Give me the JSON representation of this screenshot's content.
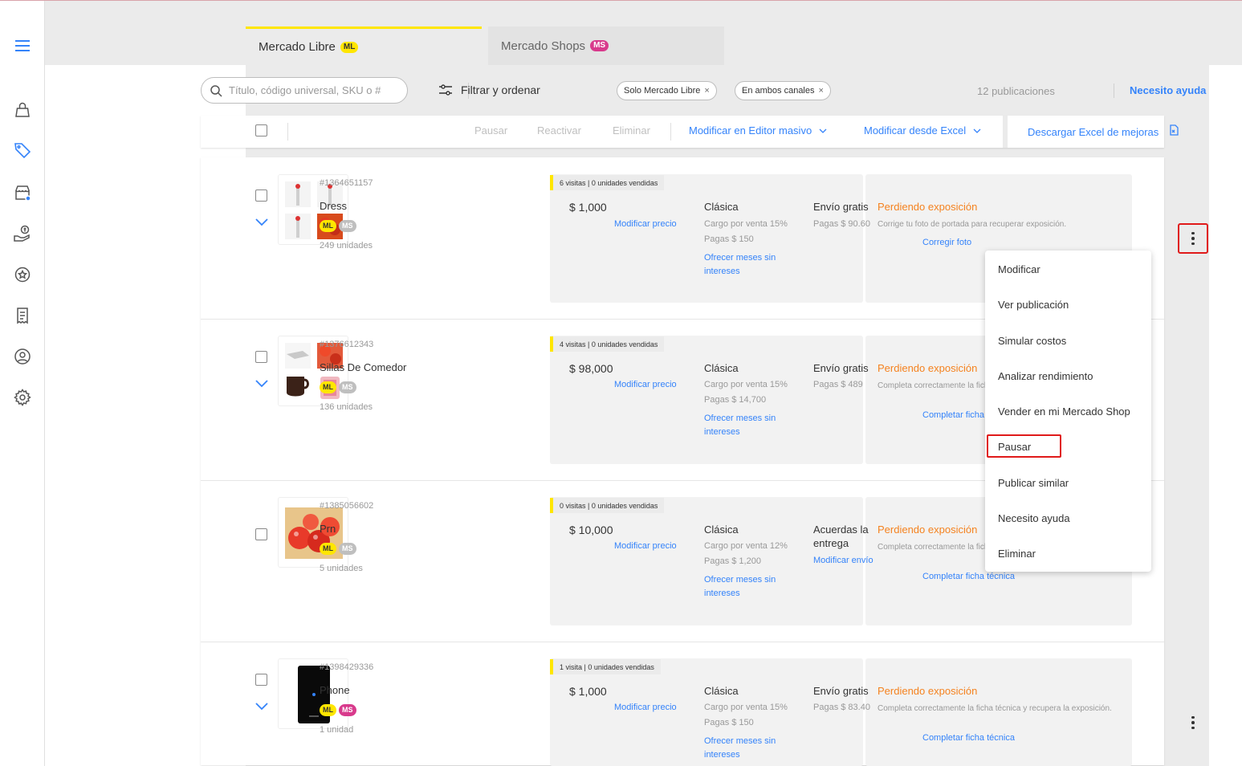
{
  "tabs": [
    {
      "label": "Mercado Libre",
      "badge": "ML"
    },
    {
      "label": "Mercado Shops",
      "badge": "MS"
    }
  ],
  "search": {
    "placeholder": "Título, código universal, SKU o #"
  },
  "filter": {
    "label": "Filtrar y ordenar"
  },
  "chips": [
    {
      "label": "Solo Mercado Libre"
    },
    {
      "label": "En ambos canales"
    }
  ],
  "header": {
    "count": "12 publicaciones",
    "help": "Necesito ayuda"
  },
  "actionbar": {
    "pause": "Pausar",
    "reactivate": "Reactivar",
    "delete": "Eliminar",
    "bulk_editor": "Modificar en Editor masivo",
    "excel": "Modificar desde Excel",
    "download": "Descargar Excel de mejoras"
  },
  "badges": {
    "ml": "ML",
    "ms": "MS"
  },
  "listings": [
    {
      "id": "#1364651157",
      "title": "Dress",
      "units": "249 unidades",
      "ms_active": false,
      "visits": "6 visitas | 0 unidades vendidas",
      "price": "$ 1,000",
      "price_link": "Modificar precio",
      "type": "Clásica",
      "fee": "Cargo por venta 15%",
      "pay": "Pagas $ 150",
      "installments": "Ofrecer meses sin intereses",
      "shipping": "Envío gratis",
      "shipping_sub": "Pagas $ 90.60",
      "warn": "Perdiendo exposición",
      "warn_sub": "Corrige tu foto de portada para recuperar exposición.",
      "warn_link": "Corregir foto"
    },
    {
      "id": "#1376612343",
      "title": "Sillas De Comedor",
      "units": "136 unidades",
      "ms_active": false,
      "visits": "4 visitas | 0 unidades vendidas",
      "price": "$ 98,000",
      "price_link": "Modificar precio",
      "type": "Clásica",
      "fee": "Cargo por venta 15%",
      "pay": "Pagas $ 14,700",
      "installments": "Ofrecer meses sin intereses",
      "shipping": "Envío gratis",
      "shipping_sub": "Pagas $ 489",
      "warn": "Perdiendo exposición",
      "warn_sub": "Completa correctamente la ficha técnica y recupera la exposición.",
      "warn_link": "Completar ficha técnica"
    },
    {
      "id": "#1385056602",
      "title": "Prn",
      "units": "5 unidades",
      "ms_active": false,
      "visits": "0 visitas | 0 unidades vendidas",
      "price": "$ 10,000",
      "price_link": "Modificar precio",
      "type": "Clásica",
      "fee": "Cargo por venta 12%",
      "pay": "Pagas $ 1,200",
      "installments": "Ofrecer meses sin intereses",
      "shipping": "Acuerdas la entrega",
      "shipping_sub": "Modificar envío",
      "warn": "Perdiendo exposición",
      "warn_sub": "Completa correctamente la ficha técnica y recupera la exposición.",
      "warn_link": "Completar ficha técnica"
    },
    {
      "id": "#1398429336",
      "title": "Phone",
      "units": "1 unidad",
      "ms_active": true,
      "visits": "1 visita | 0 unidades vendidas",
      "price": "$ 1,000",
      "price_link": "Modificar precio",
      "type": "Clásica",
      "fee": "Cargo por venta 15%",
      "pay": "Pagas $ 150",
      "installments": "Ofrecer meses sin intereses",
      "shipping": "Envío gratis",
      "shipping_sub": "Pagas $ 83.40",
      "warn": "Perdiendo exposición",
      "warn_sub": "Completa correctamente la ficha técnica y recupera la exposición.",
      "warn_link": "Completar ficha técnica"
    }
  ],
  "menu": [
    "Modificar",
    "Ver publicación",
    "Simular costos",
    "Analizar rendimiento",
    "Vender en mi Mercado Shop",
    "Pausar",
    "Publicar similar",
    "Necesito ayuda",
    "Eliminar"
  ],
  "colors": {
    "accent": "#3483fa",
    "brand_yellow": "#ffe600",
    "warning": "#f5821f",
    "highlight": "#e01a1a",
    "ms_pink": "#d83a8c"
  },
  "sidebar_icons": [
    "menu-icon",
    "bag-icon",
    "tag-icon",
    "store-icon",
    "money-hand-icon",
    "star-badge-icon",
    "receipt-icon",
    "user-icon",
    "gear-icon"
  ]
}
